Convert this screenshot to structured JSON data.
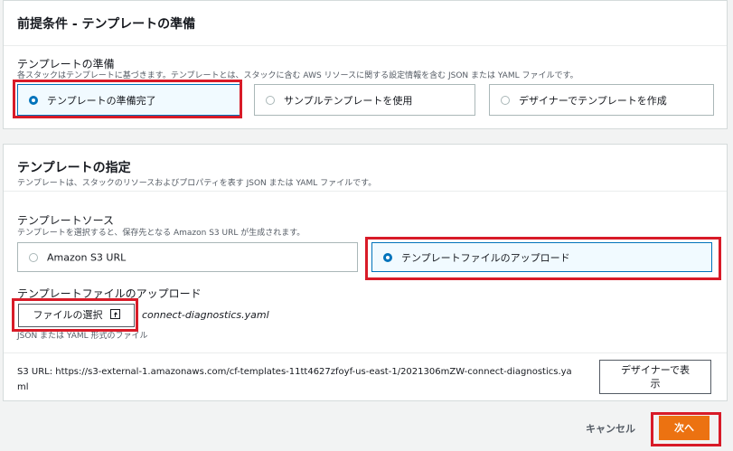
{
  "prerequisites": {
    "title": "前提条件 - テンプレートの準備",
    "prepare_label": "テンプレートの準備",
    "prepare_desc": "各スタックはテンプレートに基づきます。テンプレートとは、スタックに含む AWS リソースに関する設定情報を含む JSON または YAML ファイルです。",
    "options": [
      {
        "label": "テンプレートの準備完了",
        "selected": true
      },
      {
        "label": "サンプルテンプレートを使用",
        "selected": false
      },
      {
        "label": "デザイナーでテンプレートを作成",
        "selected": false
      }
    ]
  },
  "specify": {
    "title": "テンプレートの指定",
    "desc": "テンプレートは、スタックのリソースおよびプロパティを表す JSON または YAML ファイルです。",
    "source_label": "テンプレートソース",
    "source_desc": "テンプレートを選択すると、保存先となる Amazon S3 URL が生成されます。",
    "source_options": [
      {
        "label": "Amazon S3 URL",
        "selected": false
      },
      {
        "label": "テンプレートファイルのアップロード",
        "selected": true
      }
    ],
    "upload_label": "テンプレートファイルのアップロード",
    "choose_file_label": "ファイルの選択",
    "file_name": "connect-diagnostics.yaml",
    "file_hint": "JSON または YAML 形式のファイル",
    "s3_url_line1": "S3 URL:  https://s3-external-1.amazonaws.com/cf-templates-11tt4627zfoyf-us-east-1/2021306mZW-connect-diagnostics.ya",
    "s3_url_line2": "ml",
    "designer_btn_line1": "デザイナーで表",
    "designer_btn_line2": "示"
  },
  "footer": {
    "cancel_label": "キャンセル",
    "next_label": "次へ"
  },
  "colors": {
    "accent": "#0073bb",
    "primary_button": "#ec7211",
    "highlight": "#d81b28"
  }
}
